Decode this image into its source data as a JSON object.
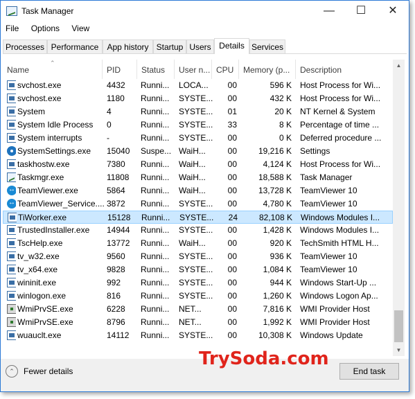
{
  "window": {
    "title": "Task Manager"
  },
  "menu": [
    "File",
    "Options",
    "View"
  ],
  "tabs": [
    "Processes",
    "Performance",
    "App history",
    "Startup",
    "Users",
    "Details",
    "Services"
  ],
  "active_tab": "Details",
  "columns": {
    "name": "Name",
    "pid": "PID",
    "status": "Status",
    "user": "User n...",
    "cpu": "CPU",
    "memory": "Memory (p...",
    "description": "Description"
  },
  "rows": [
    {
      "icon": "service-icon",
      "name": "svchost.exe",
      "pid": "4432",
      "status": "Runni...",
      "user": "LOCA...",
      "cpu": "00",
      "memory": "596 K",
      "description": "Host Process for Wi..."
    },
    {
      "icon": "service-icon",
      "name": "svchost.exe",
      "pid": "1180",
      "status": "Runni...",
      "user": "SYSTE...",
      "cpu": "00",
      "memory": "432 K",
      "description": "Host Process for Wi..."
    },
    {
      "icon": "service-icon",
      "name": "System",
      "pid": "4",
      "status": "Runni...",
      "user": "SYSTE...",
      "cpu": "01",
      "memory": "20 K",
      "description": "NT Kernel & System"
    },
    {
      "icon": "service-icon",
      "name": "System Idle Process",
      "pid": "0",
      "status": "Runni...",
      "user": "SYSTE...",
      "cpu": "33",
      "memory": "8 K",
      "description": "Percentage of time ..."
    },
    {
      "icon": "service-icon",
      "name": "System interrupts",
      "pid": "-",
      "status": "Runni...",
      "user": "SYSTE...",
      "cpu": "00",
      "memory": "0 K",
      "description": "Deferred procedure ..."
    },
    {
      "icon": "gear-icon",
      "name": "SystemSettings.exe",
      "pid": "15040",
      "status": "Suspe...",
      "user": "WaiH...",
      "cpu": "00",
      "memory": "19,216 K",
      "description": "Settings"
    },
    {
      "icon": "service-icon",
      "name": "taskhostw.exe",
      "pid": "7380",
      "status": "Runni...",
      "user": "WaiH...",
      "cpu": "00",
      "memory": "4,124 K",
      "description": "Host Process for Wi..."
    },
    {
      "icon": "task-manager-icon",
      "name": "Taskmgr.exe",
      "pid": "11808",
      "status": "Runni...",
      "user": "WaiH...",
      "cpu": "00",
      "memory": "18,588 K",
      "description": "Task Manager"
    },
    {
      "icon": "teamviewer-icon",
      "name": "TeamViewer.exe",
      "pid": "5864",
      "status": "Runni...",
      "user": "WaiH...",
      "cpu": "00",
      "memory": "13,728 K",
      "description": "TeamViewer 10"
    },
    {
      "icon": "teamviewer-icon",
      "name": "TeamViewer_Service....",
      "pid": "3872",
      "status": "Runni...",
      "user": "SYSTE...",
      "cpu": "00",
      "memory": "4,780 K",
      "description": "TeamViewer 10"
    },
    {
      "icon": "service-icon",
      "name": "TiWorker.exe",
      "pid": "15128",
      "status": "Runni...",
      "user": "SYSTE...",
      "cpu": "24",
      "memory": "82,108 K",
      "description": "Windows Modules I...",
      "selected": true
    },
    {
      "icon": "service-icon",
      "name": "TrustedInstaller.exe",
      "pid": "14944",
      "status": "Runni...",
      "user": "SYSTE...",
      "cpu": "00",
      "memory": "1,428 K",
      "description": "Windows Modules I..."
    },
    {
      "icon": "service-icon",
      "name": "TscHelp.exe",
      "pid": "13772",
      "status": "Runni...",
      "user": "WaiH...",
      "cpu": "00",
      "memory": "920 K",
      "description": "TechSmith HTML H..."
    },
    {
      "icon": "service-icon",
      "name": "tv_w32.exe",
      "pid": "9560",
      "status": "Runni...",
      "user": "SYSTE...",
      "cpu": "00",
      "memory": "936 K",
      "description": "TeamViewer 10"
    },
    {
      "icon": "service-icon",
      "name": "tv_x64.exe",
      "pid": "9828",
      "status": "Runni...",
      "user": "SYSTE...",
      "cpu": "00",
      "memory": "1,084 K",
      "description": "TeamViewer 10"
    },
    {
      "icon": "service-icon",
      "name": "wininit.exe",
      "pid": "992",
      "status": "Runni...",
      "user": "SYSTE...",
      "cpu": "00",
      "memory": "944 K",
      "description": "Windows Start-Up ..."
    },
    {
      "icon": "service-icon",
      "name": "winlogon.exe",
      "pid": "816",
      "status": "Runni...",
      "user": "SYSTE...",
      "cpu": "00",
      "memory": "1,260 K",
      "description": "Windows Logon Ap..."
    },
    {
      "icon": "wmi-icon",
      "name": "WmiPrvSE.exe",
      "pid": "6228",
      "status": "Runni...",
      "user": "NET...",
      "cpu": "00",
      "memory": "7,816 K",
      "description": "WMI Provider Host"
    },
    {
      "icon": "wmi-icon",
      "name": "WmiPrvSE.exe",
      "pid": "8796",
      "status": "Runni...",
      "user": "NET...",
      "cpu": "00",
      "memory": "1,992 K",
      "description": "WMI Provider Host"
    },
    {
      "icon": "service-icon",
      "name": "wuauclt.exe",
      "pid": "14112",
      "status": "Runni...",
      "user": "SYSTE...",
      "cpu": "00",
      "memory": "10,308 K",
      "description": "Windows Update"
    }
  ],
  "footer": {
    "fewer_details": "Fewer details",
    "end_task": "End task"
  },
  "watermark": "TrySoda.com",
  "colors": {
    "selection": "#cce8ff",
    "watermark": "#e0241b",
    "accent_border": "#2b79d6"
  }
}
